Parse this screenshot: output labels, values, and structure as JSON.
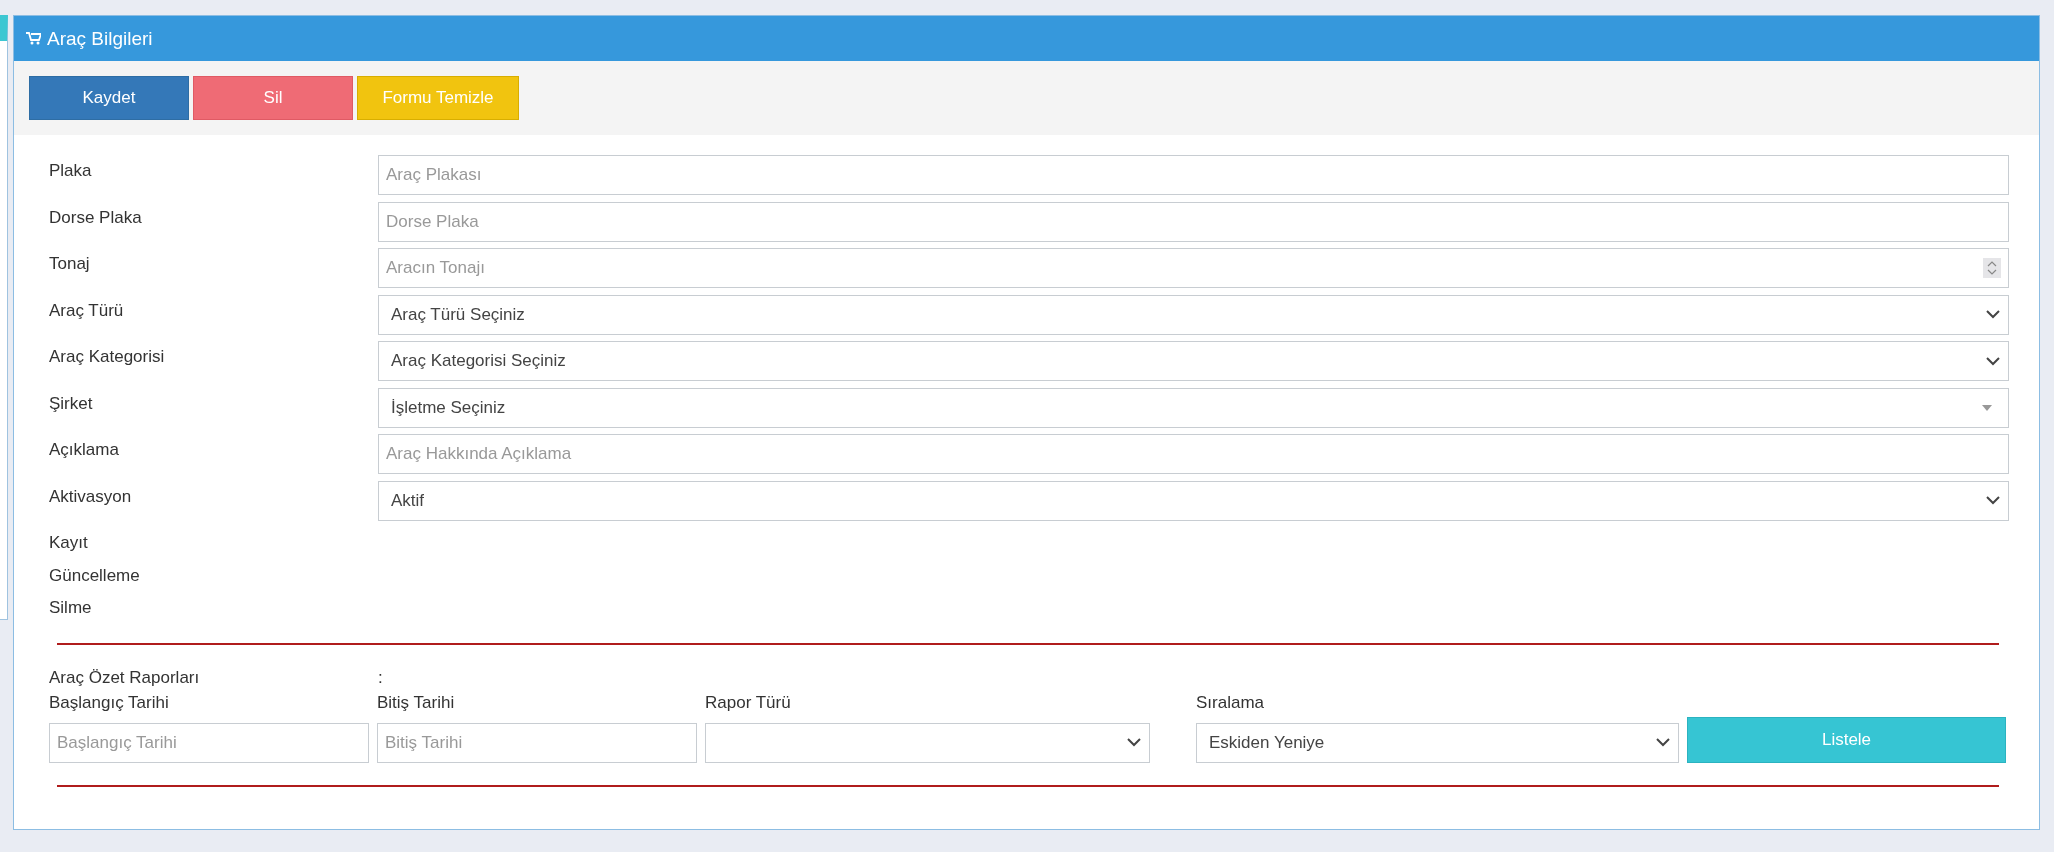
{
  "panel": {
    "title": "Araç Bilgileri"
  },
  "toolbar": [
    {
      "label": "Kaydet",
      "kind": "primary"
    },
    {
      "label": "Sil",
      "kind": "danger"
    },
    {
      "label": "Formu Temizle",
      "kind": "warning"
    }
  ],
  "form": [
    {
      "label": "Plaka",
      "kind": "text",
      "placeholder": "Araç Plakası"
    },
    {
      "label": "Dorse Plaka",
      "kind": "text",
      "placeholder": "Dorse Plaka"
    },
    {
      "label": "Tonaj",
      "kind": "number",
      "placeholder": "Aracın Tonajı"
    },
    {
      "label": "Araç Türü",
      "kind": "select",
      "value": "Araç Türü Seçiniz"
    },
    {
      "label": "Araç Kategorisi",
      "kind": "select",
      "value": "Araç Kategorisi Seçiniz"
    },
    {
      "label": "Şirket",
      "kind": "combo",
      "value": "İşletme Seçiniz"
    },
    {
      "label": "Açıklama",
      "kind": "text",
      "placeholder": "Araç Hakkında Açıklama"
    },
    {
      "label": "Aktivasyon",
      "kind": "select",
      "value": "Aktif"
    }
  ],
  "audit": [
    "Kayıt",
    "Güncelleme",
    "Silme"
  ],
  "reports": {
    "title": "Araç Özet Raporları",
    "separator": ":",
    "fields": [
      {
        "label": "Başlangıç Tarihi",
        "kind": "text",
        "placeholder": "Başlangıç Tarihi"
      },
      {
        "label": "Bitiş Tarihi",
        "kind": "text",
        "placeholder": "Bitiş Tarihi"
      },
      {
        "label": "Rapor Türü",
        "kind": "select"
      },
      {
        "label": "Sıralama",
        "kind": "select",
        "value": "Eskiden Yeniye"
      }
    ],
    "button": "Listele"
  }
}
